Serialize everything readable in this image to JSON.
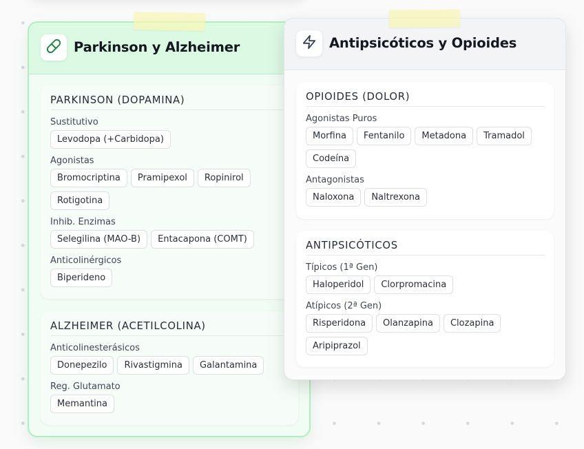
{
  "cards": [
    {
      "title": "Parkinson y Alzheimer",
      "icon": "pill-icon",
      "sections": [
        {
          "title": "PARKINSON (DOPAMINA)",
          "groups": [
            {
              "label": "Sustitutivo",
              "drugs": [
                "Levodopa (+Carbidopa)"
              ]
            },
            {
              "label": "Agonistas",
              "drugs": [
                "Bromocriptina",
                "Pramipexol",
                "Ropinirol",
                "Rotigotina"
              ]
            },
            {
              "label": "Inhib. Enzimas",
              "drugs": [
                "Selegilina (MAO-B)",
                "Entacapona (COMT)"
              ]
            },
            {
              "label": "Anticolinérgicos",
              "drugs": [
                "Biperideno"
              ]
            }
          ]
        },
        {
          "title": "ALZHEIMER (ACETILCOLINA)",
          "groups": [
            {
              "label": "Anticolinesterásicos",
              "drugs": [
                "Donepezilo",
                "Rivastigmina",
                "Galantamina"
              ]
            },
            {
              "label": "Reg. Glutamato",
              "drugs": [
                "Memantina"
              ]
            }
          ]
        }
      ]
    },
    {
      "title": "Antipsicóticos y Opioides",
      "icon": "lightning-bolt-icon",
      "sections": [
        {
          "title": "OPIOIDES (DOLOR)",
          "groups": [
            {
              "label": "Agonistas Puros",
              "drugs": [
                "Morfina",
                "Fentanilo",
                "Metadona",
                "Tramadol",
                "Codeína"
              ]
            },
            {
              "label": "Antagonistas",
              "drugs": [
                "Naloxona",
                "Naltrexona"
              ]
            }
          ]
        },
        {
          "title": "ANTIPSICÓTICOS",
          "groups": [
            {
              "label": "Típicos (1ª Gen)",
              "drugs": [
                "Haloperidol",
                "Clorpromacina"
              ]
            },
            {
              "label": "Atípicos (2ª Gen)",
              "drugs": [
                "Risperidona",
                "Olanzapina",
                "Clozapina",
                "Aripiprazol"
              ]
            }
          ]
        }
      ]
    }
  ],
  "colors": {
    "left_card_bg": "#f1fcf4",
    "left_header_bg": "#dcf9e4",
    "left_border": "#b2ecc1",
    "right_header_bg": "#f3f4f6",
    "tape": "#f6f5b4",
    "icon_stroke": "#15803d",
    "icon_stroke_dark": "#374151"
  }
}
